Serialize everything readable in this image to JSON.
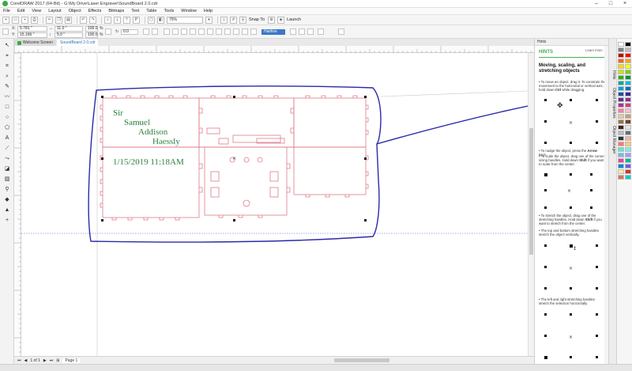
{
  "window": {
    "title": "CorelDRAW 2017 (64-Bit) - G:\\My Drive\\Laser Engraver\\SoundBoard 2.0.cdr",
    "controls": [
      "–",
      "□",
      "×"
    ]
  },
  "menu": [
    "File",
    "Edit",
    "View",
    "Layout",
    "Object",
    "Effects",
    "Bitmaps",
    "Text",
    "Table",
    "Tools",
    "Window",
    "Help"
  ],
  "toolbar": {
    "zoom": "75%",
    "snap_to": "Snap To",
    "launch": "Launch"
  },
  "property_bar": {
    "x_label": "X:",
    "x_value": "5.781 \"",
    "y_label": "Y:",
    "y_value": "15.166 \"",
    "w_value": "11.0 \"",
    "h_value": "5.0 \"",
    "scale_w": "100.0",
    "scale_h": "100.0",
    "scale_unit": "%",
    "angle": "0.0",
    "outline": "Hairline"
  },
  "doc_tabs": [
    {
      "label": "Welcome Screen",
      "active": false
    },
    {
      "label": "SoundBoard 2.0.cdr",
      "active": true
    }
  ],
  "canvas": {
    "text_lines": [
      "Sir",
      "Samuel",
      "Addison",
      "Haessly"
    ],
    "date_text": "1/15/2019 11:18AM",
    "text_color": "#1a5c2e",
    "outline_color": "#e07a88",
    "annotation_color": "#2a2aa8"
  },
  "status": {
    "page_nav": "1 of 1",
    "page_tab": "Page 1"
  },
  "docker": {
    "header": "Hints",
    "hints_title": "HINTS",
    "learn_more": "Learn more",
    "heading": "Moving, scaling, and stretching objects",
    "hints": [
      {
        "pre": "• To move an object, drag it. To constrain the movement to the horizontal or vertical axis, hold down ",
        "key": "Ctrl",
        "post": " while dragging."
      },
      {
        "pre": "• To nudge the object, press the ",
        "key": "Arrow",
        "post": " keys."
      },
      {
        "pre": "• To scale the object, drag one of the corner sizing handles. Hold down ",
        "key": "Shift",
        "post": " if you want to scale from the center."
      },
      {
        "pre": "• To stretch the object, drag one of the stretching handles. Hold down ",
        "key": "Shift",
        "post": " if you want to stretch from the center."
      },
      {
        "pre": "• The top and bottom stretching handles stretch the object vertically.",
        "key": "",
        "post": ""
      },
      {
        "pre": "• The left and right stretching handles stretch the selection horizontally.",
        "key": "",
        "post": ""
      }
    ]
  },
  "side_tabs": [
    "Hints",
    "Object Properties",
    "Object Manager"
  ],
  "palette_colors": [
    "#ffffff",
    "#000000",
    "#7f7f7f",
    "#bfbfbf",
    "#c00000",
    "#ff0000",
    "#ff6600",
    "#ffa500",
    "#ffd700",
    "#ffff00",
    "#c8e600",
    "#7fd000",
    "#33b000",
    "#008f3c",
    "#00a88f",
    "#00bcd4",
    "#00a0e0",
    "#0070c0",
    "#1f4ea0",
    "#2a2aa8",
    "#5a2ea0",
    "#8e2ea0",
    "#b0308a",
    "#d63d7a",
    "#ff7fa0",
    "#ffc0cb",
    "#e8c8a0",
    "#c8a070",
    "#a07040",
    "#704020",
    "#402010",
    "#dfe6e9",
    "#b2bec3",
    "#636e72",
    "#2d3436",
    "#fab1a0",
    "#ff7675",
    "#fdcb6e",
    "#55efc4",
    "#81ecec",
    "#74b9ff",
    "#a29bfe",
    "#e84393",
    "#00b894",
    "#0984e3",
    "#6c5ce7",
    "#ffeaa7",
    "#d63031",
    "#e17055",
    "#00cec9"
  ]
}
